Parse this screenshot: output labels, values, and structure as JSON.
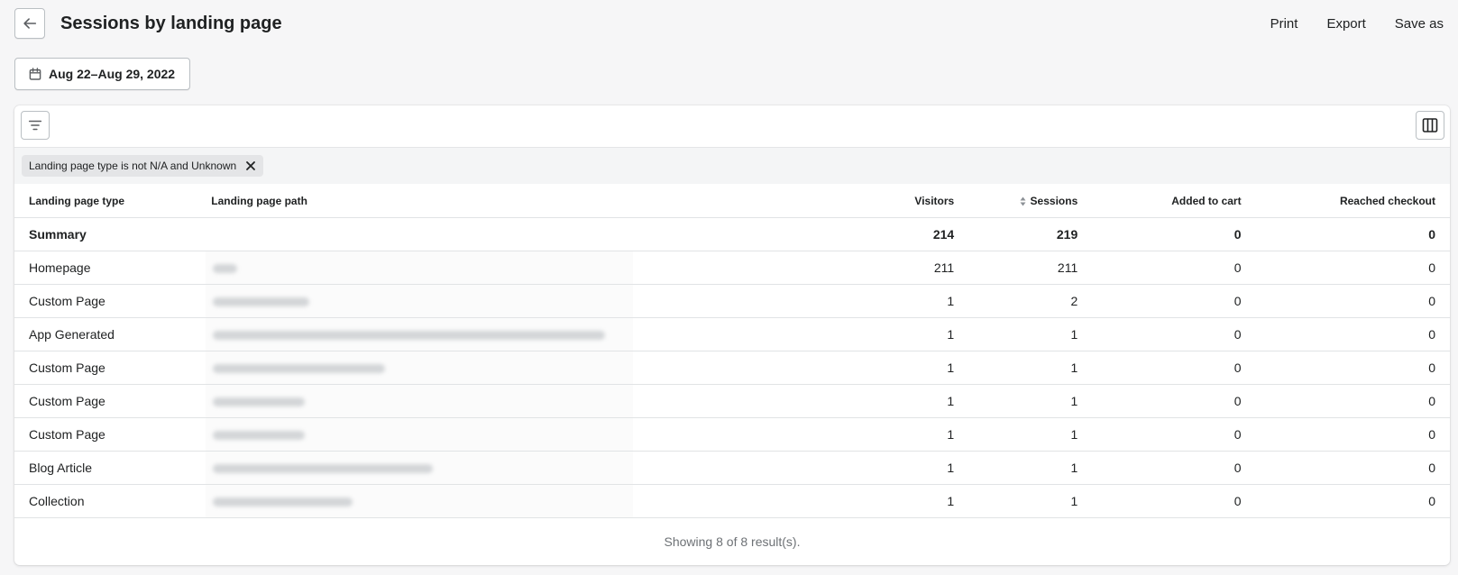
{
  "header": {
    "title": "Sessions by landing page",
    "actions": {
      "print": "Print",
      "export": "Export",
      "save_as": "Save as"
    }
  },
  "date_range": "Aug 22–Aug 29, 2022",
  "filter_chip": "Landing page type is not N/A and Unknown",
  "table": {
    "columns": [
      "Landing page type",
      "Landing page path",
      "Visitors",
      "Sessions",
      "Added to cart",
      "Reached checkout"
    ],
    "summary": {
      "label": "Summary",
      "visitors": "214",
      "sessions": "219",
      "added_to_cart": "0",
      "reached_checkout": "0"
    },
    "rows": [
      {
        "type": "Homepage",
        "visitors": "211",
        "sessions": "211",
        "added_to_cart": "0",
        "reached_checkout": "0",
        "path_redacted": 0.06
      },
      {
        "type": "Custom Page",
        "visitors": "1",
        "sessions": "2",
        "added_to_cart": "0",
        "reached_checkout": "0",
        "path_redacted": 0.24
      },
      {
        "type": "App Generated",
        "visitors": "1",
        "sessions": "1",
        "added_to_cart": "0",
        "reached_checkout": "0",
        "path_redacted": 0.98
      },
      {
        "type": "Custom Page",
        "visitors": "1",
        "sessions": "1",
        "added_to_cart": "0",
        "reached_checkout": "0",
        "path_redacted": 0.43
      },
      {
        "type": "Custom Page",
        "visitors": "1",
        "sessions": "1",
        "added_to_cart": "0",
        "reached_checkout": "0",
        "path_redacted": 0.23
      },
      {
        "type": "Custom Page",
        "visitors": "1",
        "sessions": "1",
        "added_to_cart": "0",
        "reached_checkout": "0",
        "path_redacted": 0.23
      },
      {
        "type": "Blog Article",
        "visitors": "1",
        "sessions": "1",
        "added_to_cart": "0",
        "reached_checkout": "0",
        "path_redacted": 0.55
      },
      {
        "type": "Collection",
        "visitors": "1",
        "sessions": "1",
        "added_to_cart": "0",
        "reached_checkout": "0",
        "path_redacted": 0.35
      }
    ]
  },
  "footer": "Showing 8 of 8 result(s).",
  "icons": [
    "arrow-left-icon",
    "calendar-icon",
    "filter-icon",
    "columns-icon",
    "close-icon",
    "sort-icon"
  ]
}
